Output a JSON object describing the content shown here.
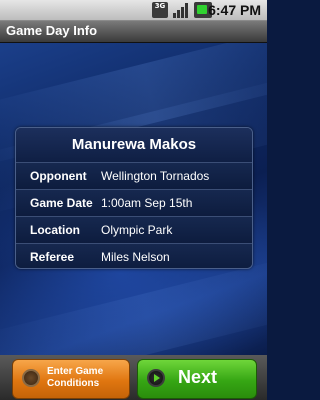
{
  "status_bar": {
    "network_label": "3G",
    "time": "6:47 PM",
    "icons": [
      "3g-icon",
      "signal-icon",
      "battery-icon"
    ]
  },
  "title_bar": {
    "title": "Game Day Info"
  },
  "card": {
    "team_name": "Manurewa Makos",
    "rows": [
      {
        "label": "Opponent",
        "value": "Wellington Tornados"
      },
      {
        "label": "Game Date",
        "value": "1:00am Sep 15th"
      },
      {
        "label": "Location",
        "value": "Olympic Park"
      },
      {
        "label": "Referee",
        "value": "Miles Nelson"
      }
    ]
  },
  "buttons": {
    "conditions_label": "Enter Game Conditions",
    "next_label": "Next"
  },
  "colors": {
    "conditions_button": "#e07610",
    "next_button": "#36a614",
    "background": "#0f2a66"
  }
}
